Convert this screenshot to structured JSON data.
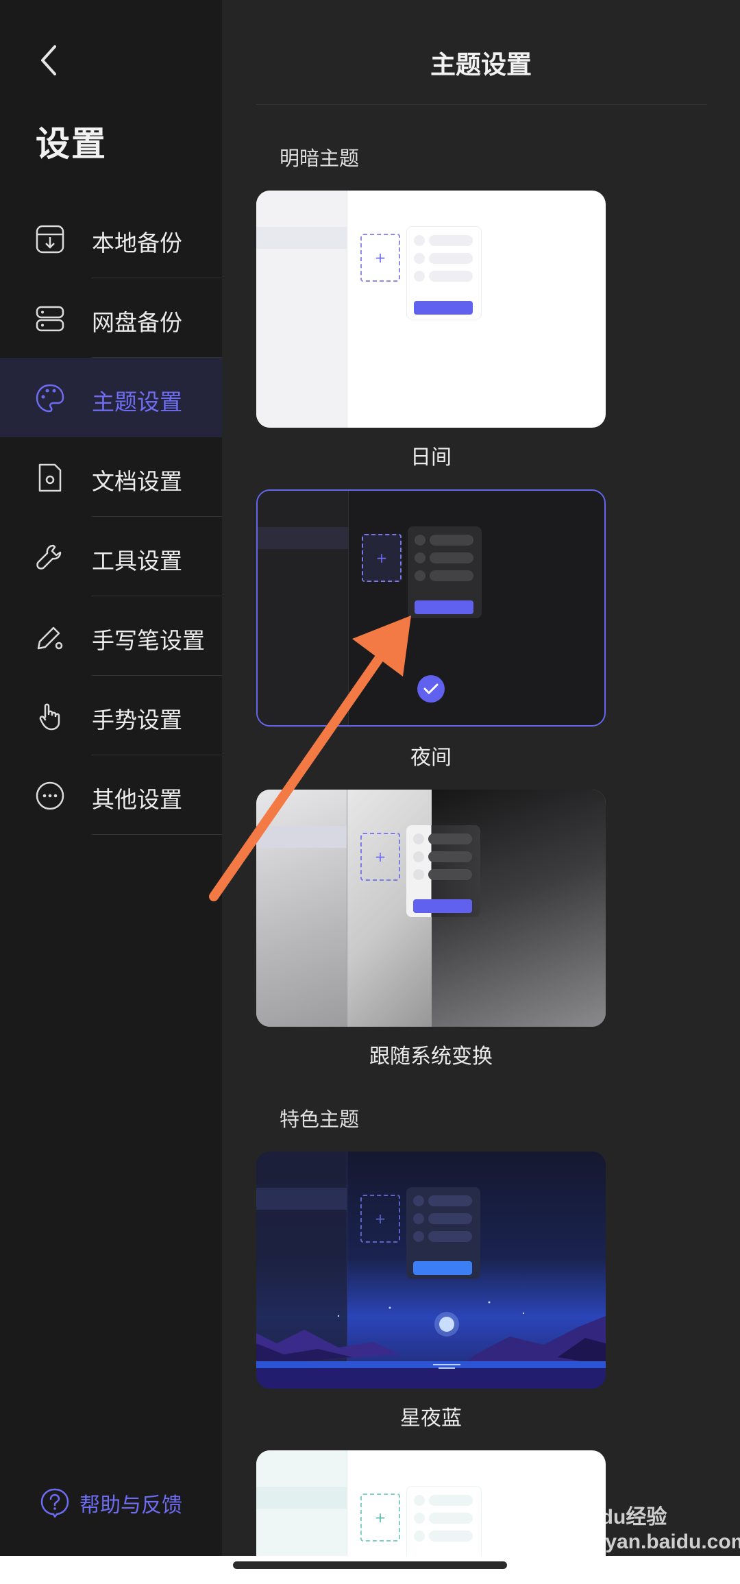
{
  "sidebar": {
    "title": "设置",
    "items": [
      {
        "label": "本地备份",
        "icon": "local-backup-icon"
      },
      {
        "label": "网盘备份",
        "icon": "cloud-disk-icon"
      },
      {
        "label": "主题设置",
        "icon": "palette-icon",
        "active": true
      },
      {
        "label": "文档设置",
        "icon": "document-settings-icon"
      },
      {
        "label": "工具设置",
        "icon": "wrench-icon"
      },
      {
        "label": "手写笔设置",
        "icon": "pen-settings-icon"
      },
      {
        "label": "手势设置",
        "icon": "hand-gesture-icon"
      },
      {
        "label": "其他设置",
        "icon": "more-icon"
      }
    ],
    "help_label": "帮助与反馈"
  },
  "header": {
    "title": "主题设置"
  },
  "sections": {
    "basic": "明暗主题",
    "featured": "特色主题"
  },
  "themes": [
    {
      "name": "日间",
      "selected": false
    },
    {
      "name": "夜间",
      "selected": true
    },
    {
      "name": "跟随系统变换",
      "selected": false
    },
    {
      "name": "星夜蓝",
      "selected": false
    }
  ],
  "colors": {
    "accent": "#6d6cf3",
    "arrow": "#f37a45",
    "background": "#252526",
    "sidebar": "#1a1a1b"
  },
  "watermark": "Baidu经验 jingyan.baidu.com"
}
